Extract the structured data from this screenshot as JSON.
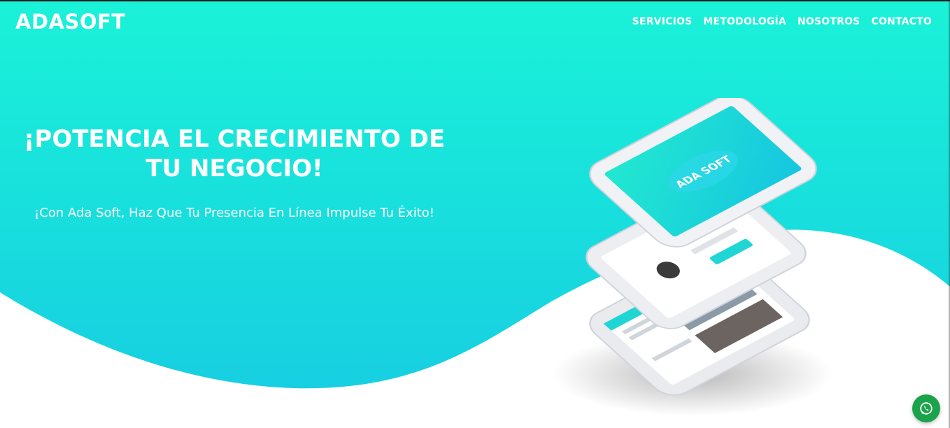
{
  "brand": {
    "name": "ADASOFT"
  },
  "nav": {
    "items": [
      {
        "label": "SERVICIOS"
      },
      {
        "label": "METODOLOGÍA"
      },
      {
        "label": "NOSOTROS"
      },
      {
        "label": "CONTACTO"
      }
    ]
  },
  "hero": {
    "headline": "¡POTENCIA EL CRECIMIENTO DE TU NEGOCIO!",
    "subheadline": "¡Con Ada Soft, Haz Que Tu Presencia En Línea Impulse Tu Éxito!",
    "mockup_logo": "ADA SOFT"
  },
  "floating": {
    "icon": "whatsapp-icon"
  },
  "colors": {
    "gradient_top": "#1af2d8",
    "gradient_bottom": "#17d3e0",
    "whatsapp": "#1aa34a"
  }
}
